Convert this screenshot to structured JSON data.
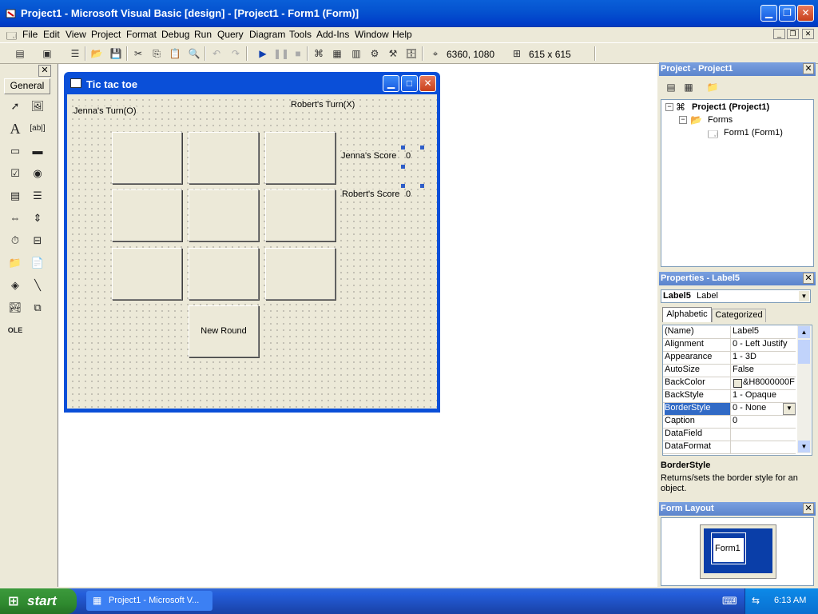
{
  "window": {
    "title": "Project1 - Microsoft Visual Basic [design] - [Project1 - Form1 (Form)]"
  },
  "menu": [
    "File",
    "Edit",
    "View",
    "Project",
    "Format",
    "Debug",
    "Run",
    "Query",
    "Diagram",
    "Tools",
    "Add-Ins",
    "Window",
    "Help"
  ],
  "toolbar": {
    "position_readout": "6360, 1080",
    "size_readout": "615 x 615"
  },
  "toolbox": {
    "tab_label": "General"
  },
  "form": {
    "title": "Tic tac toe",
    "jenna_turn": "Jenna's Turn(O)",
    "robert_turn": "Robert's Turn(X)",
    "jenna_score_label": "Jenna's Score",
    "jenna_score_value": "0",
    "robert_score_label": "Robert's Score",
    "robert_score_value": "0",
    "new_round_label": "New Round"
  },
  "project_panel": {
    "title": "Project - Project1",
    "root": "Project1 (Project1)",
    "folder": "Forms",
    "form": "Form1 (Form1)"
  },
  "properties_panel": {
    "title": "Properties - Label5",
    "object_name": "Label5",
    "object_type": "Label",
    "tab_alphabetic": "Alphabetic",
    "tab_categorized": "Categorized",
    "rows": [
      {
        "name": "(Name)",
        "value": "Label5"
      },
      {
        "name": "Alignment",
        "value": "0 - Left Justify"
      },
      {
        "name": "Appearance",
        "value": "1 - 3D"
      },
      {
        "name": "AutoSize",
        "value": "False"
      },
      {
        "name": "BackColor",
        "value": "&H8000000F"
      },
      {
        "name": "BackStyle",
        "value": "1 - Opaque"
      },
      {
        "name": "BorderStyle",
        "value": "0 - None"
      },
      {
        "name": "Caption",
        "value": "0"
      },
      {
        "name": "DataField",
        "value": ""
      },
      {
        "name": "DataFormat",
        "value": ""
      }
    ],
    "desc_title": "BorderStyle",
    "desc_text": "Returns/sets the border style for an object."
  },
  "layout_panel": {
    "title": "Form Layout",
    "form_label": "Form1"
  },
  "taskbar": {
    "start_label": "start",
    "task_label": "Project1 - Microsoft V...",
    "clock": "6:13 AM"
  },
  "colors": {
    "xp_blue": "#0553d0",
    "selection": "#316ac5",
    "start_green": "#2f8a2f"
  }
}
